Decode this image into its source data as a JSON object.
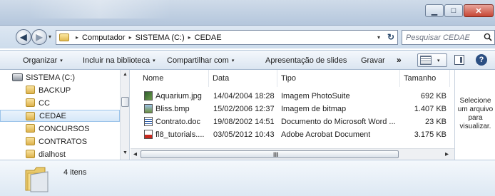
{
  "window": {
    "minimize_glyph": "▁",
    "maximize_glyph": "□",
    "close_glyph": "✕"
  },
  "navigation": {
    "back_glyph": "◀",
    "forward_glyph": "▶",
    "history_glyph": "▾"
  },
  "address": {
    "breadcrumbs": [
      "Computador",
      "SISTEMA (C:)",
      "CEDAE"
    ],
    "separator": "▸",
    "dropdown_glyph": "▾",
    "refresh_glyph": "↻"
  },
  "search": {
    "placeholder": "Pesquisar CEDAE",
    "icon": "search-icon"
  },
  "toolbar": {
    "organize_label": "Organizar",
    "include_library_label": "Incluir na biblioteca",
    "share_label": "Compartilhar com",
    "slideshow_label": "Apresentação de slides",
    "burn_label": "Gravar",
    "more_glyph": "»",
    "caret": "▾",
    "help_glyph": "?"
  },
  "nav_pane": {
    "root": "SISTEMA (C:)",
    "items": [
      {
        "label": "BACKUP",
        "selected": false
      },
      {
        "label": "CC",
        "selected": false
      },
      {
        "label": "CEDAE",
        "selected": true
      },
      {
        "label": "CONCURSOS",
        "selected": false
      },
      {
        "label": "CONTRATOS",
        "selected": false
      },
      {
        "label": "dialhost",
        "selected": false
      }
    ],
    "scroll_up_glyph": "▲",
    "scroll_down_glyph": "▼"
  },
  "file_list": {
    "columns": [
      "Nome",
      "Data",
      "Tipo",
      "Tamanho"
    ],
    "rows": [
      {
        "name": "Aquarium.jpg",
        "date": "14/04/2004 18:28",
        "type": "Imagem PhotoSuite",
        "size": "692 KB",
        "icon": "image-icon"
      },
      {
        "name": "Bliss.bmp",
        "date": "15/02/2006 12:37",
        "type": "Imagem de bitmap",
        "size": "1.407 KB",
        "icon": "bitmap-icon"
      },
      {
        "name": "Contrato.doc",
        "date": "19/08/2002 14:51",
        "type": "Documento do Microsoft Word ...",
        "size": "23 KB",
        "icon": "word-icon"
      },
      {
        "name": "fl8_tutorials....",
        "date": "03/05/2012 10:43",
        "type": "Adobe Acrobat Document",
        "size": "3.175 KB",
        "icon": "pdf-icon"
      }
    ],
    "hscroll_left_glyph": "◂",
    "hscroll_right_glyph": "▸",
    "grip_glyph": "III"
  },
  "preview_pane": {
    "lines": [
      "Selecione",
      "um arquivo",
      "para",
      "visualizar."
    ]
  },
  "details_pane": {
    "item_count": "4 itens"
  }
}
